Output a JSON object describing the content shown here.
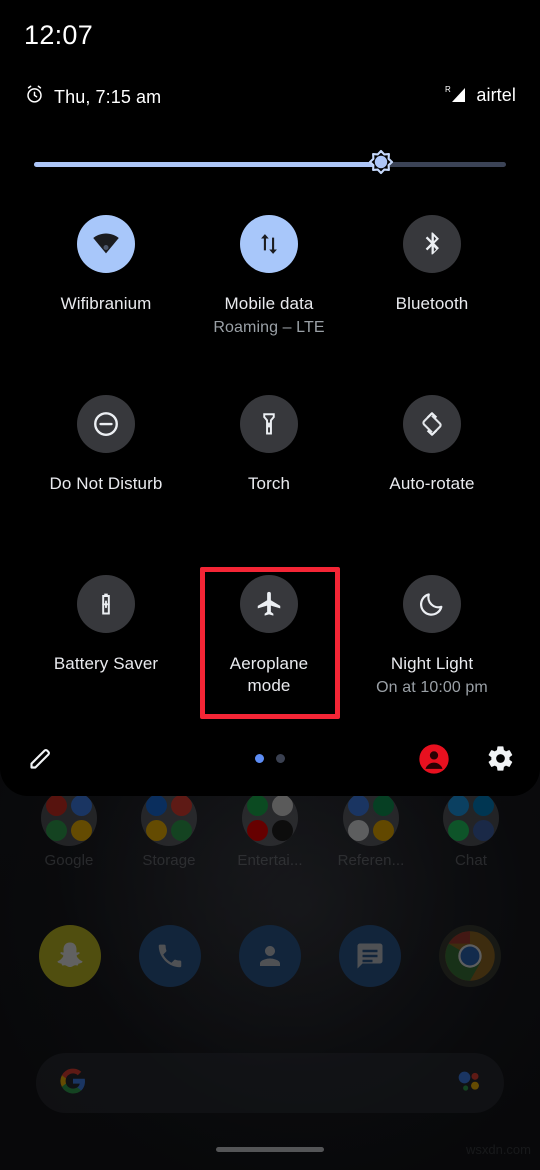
{
  "status_bar": {
    "clock": "12:07",
    "alarm_icon": "alarm-clock-icon",
    "alarm_text": "Thu, 7:15 am",
    "signal_icon": "signal-roaming-icon",
    "roaming_indicator": "R",
    "carrier": "airtel"
  },
  "brightness": {
    "name": "brightness-slider",
    "icon": "brightness-sun-icon",
    "value_percent": 72,
    "track_color": "#3b4356",
    "fill_color": "#adc6f8"
  },
  "tiles": [
    {
      "label": "Wifibranium",
      "sub": "",
      "icon": "wifi-icon",
      "state": "on",
      "name": "tile-wifi"
    },
    {
      "label": "Mobile data",
      "sub": "Roaming – LTE",
      "icon": "mobile-data-icon",
      "state": "on",
      "name": "tile-mobile-data"
    },
    {
      "label": "Bluetooth",
      "sub": "",
      "icon": "bluetooth-icon",
      "state": "off",
      "name": "tile-bluetooth"
    },
    {
      "label": "Do Not Disturb",
      "sub": "",
      "icon": "do-not-disturb-icon",
      "state": "off",
      "name": "tile-do-not-disturb"
    },
    {
      "label": "Torch",
      "sub": "",
      "icon": "flashlight-icon",
      "state": "off",
      "name": "tile-torch"
    },
    {
      "label": "Auto-rotate",
      "sub": "",
      "icon": "auto-rotate-icon",
      "state": "off",
      "name": "tile-auto-rotate"
    },
    {
      "label": "Battery Saver",
      "sub": "",
      "icon": "battery-saver-icon",
      "state": "off",
      "name": "tile-battery-saver"
    },
    {
      "label": "Aeroplane mode",
      "sub": "",
      "icon": "airplane-icon",
      "state": "off",
      "name": "tile-aeroplane-mode"
    },
    {
      "label": "Night Light",
      "sub": "On at 10:00 pm",
      "icon": "moon-icon",
      "state": "off",
      "name": "tile-night-light"
    }
  ],
  "highlight": {
    "target": "Aeroplane mode",
    "color": "#f42535"
  },
  "panel_footer": {
    "edit_icon": "pencil-edit-icon",
    "user_icon": "user-avatar-icon",
    "settings_icon": "gear-settings-icon",
    "page_count": 2,
    "active_page": 1
  },
  "home_screen": {
    "folders": [
      {
        "label": "Google",
        "name": "folder-google"
      },
      {
        "label": "Storage",
        "name": "folder-storage"
      },
      {
        "label": "Entertai...",
        "name": "folder-entertainment"
      },
      {
        "label": "Referen...",
        "name": "folder-reference"
      },
      {
        "label": "Chat",
        "name": "folder-chat"
      }
    ],
    "dock": [
      {
        "name": "dock-snapchat",
        "icon": "snapchat-icon",
        "color": "#c9c326"
      },
      {
        "name": "dock-phone",
        "icon": "phone-icon",
        "color": "#2f5c93"
      },
      {
        "name": "dock-contacts",
        "icon": "contacts-icon",
        "color": "#2f5c93"
      },
      {
        "name": "dock-messages",
        "icon": "messages-icon",
        "color": "#2f5c93"
      },
      {
        "name": "dock-chrome",
        "icon": "chrome-icon",
        "color": "#4a4a3c"
      }
    ],
    "search": {
      "name": "google-search-bar",
      "logo_icon": "google-g-icon",
      "assistant_icon": "google-assistant-icon",
      "placeholder": ""
    },
    "nav_pill": "home-gesture-pill"
  },
  "watermark": "wsxdn.com"
}
